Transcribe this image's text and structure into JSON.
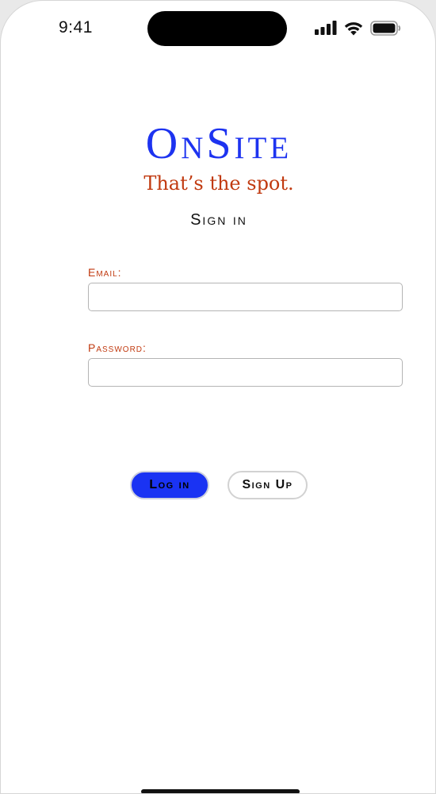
{
  "status_bar": {
    "time": "9:41",
    "icons": [
      "cellular-signal-icon",
      "wifi-icon",
      "battery-icon"
    ]
  },
  "brand": {
    "logo": "OnSite",
    "tagline": "That’s the spot.",
    "logo_color": "#1d33f0",
    "accent_color": "#c13a10"
  },
  "form": {
    "heading": "Sign in",
    "email": {
      "label": "Email:",
      "value": "",
      "placeholder": ""
    },
    "password": {
      "label": "Password:",
      "value": "",
      "placeholder": ""
    }
  },
  "actions": {
    "login_label": "Log in",
    "signup_label": "Sign Up",
    "login_color": "#1a33f3"
  }
}
